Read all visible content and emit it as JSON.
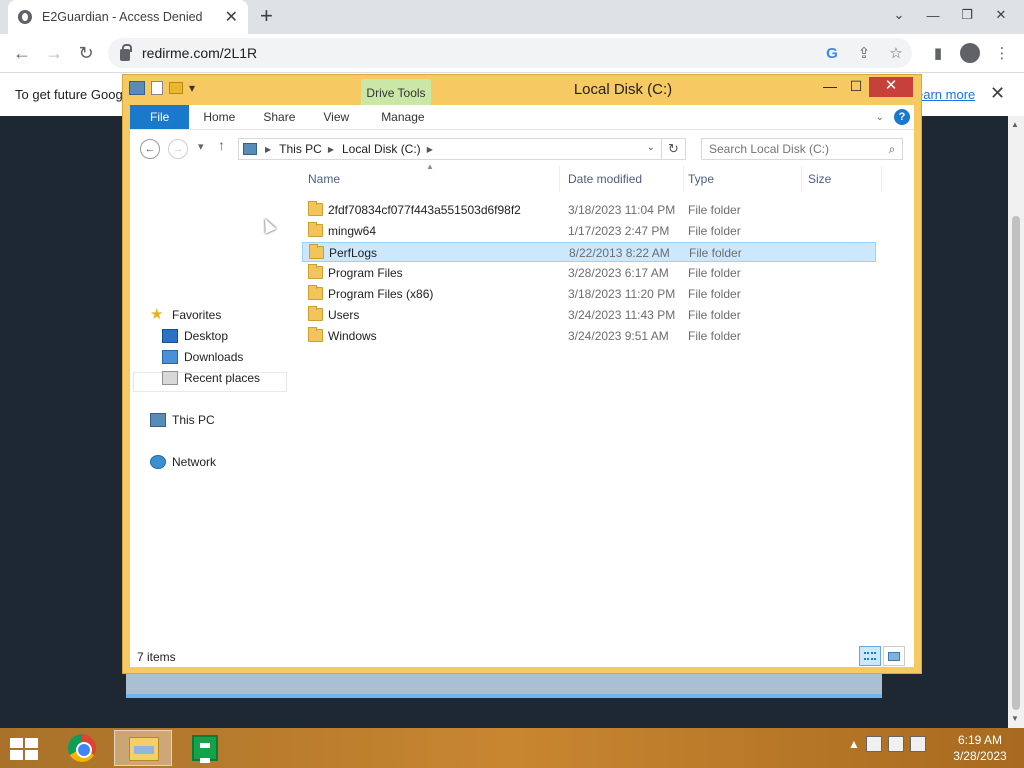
{
  "browser": {
    "tab_title": "E2Guardian - Access Denied",
    "tab_close": "✕",
    "new_tab": "+",
    "window_controls": [
      "⌄",
      "—",
      "❐",
      "✕"
    ],
    "url": "redirme.com/2L1R",
    "infobar_text": "To get future Goog",
    "infobar_link": "earn more",
    "infobar_close": "✕"
  },
  "explorer": {
    "title": "Local Disk (C:)",
    "contextual_tab": "Drive Tools",
    "controls": {
      "minimize": "—",
      "maximize": "☐",
      "close": "✕"
    },
    "ribbon_tabs": {
      "file": "File",
      "home": "Home",
      "share": "Share",
      "view": "View",
      "manage": "Manage"
    },
    "breadcrumb": [
      "This PC",
      "Local Disk (C:)"
    ],
    "search_placeholder": "Search Local Disk (C:)",
    "nav": {
      "favorites": "Favorites",
      "desktop": "Desktop",
      "downloads": "Downloads",
      "recent": "Recent places",
      "this_pc": "This PC",
      "network": "Network"
    },
    "columns": {
      "name": "Name",
      "date": "Date modified",
      "type": "Type",
      "size": "Size"
    },
    "rows": [
      {
        "name": "2fdf70834cf077f443a551503d6f98f2",
        "date": "3/18/2023 11:04 PM",
        "type": "File folder"
      },
      {
        "name": "mingw64",
        "date": "1/17/2023 2:47 PM",
        "type": "File folder"
      },
      {
        "name": "PerfLogs",
        "date": "8/22/2013 8:22 AM",
        "type": "File folder"
      },
      {
        "name": "Program Files",
        "date": "3/28/2023 6:17 AM",
        "type": "File folder"
      },
      {
        "name": "Program Files (x86)",
        "date": "3/18/2023 11:20 PM",
        "type": "File folder"
      },
      {
        "name": "Users",
        "date": "3/24/2023 11:43 PM",
        "type": "File folder"
      },
      {
        "name": "Windows",
        "date": "3/24/2023 9:51 AM",
        "type": "File folder"
      }
    ],
    "selected_row": "PerfLogs",
    "status": "7 items"
  },
  "taskbar": {
    "time": "6:19 AM",
    "date": "3/28/2023",
    "tray_up": "▲"
  },
  "colors": {
    "explorer_frame": "#f6c962",
    "ribbon_file": "#1979ca",
    "selection": "#cce8ff",
    "drive_tools": "#cbe7a8"
  }
}
